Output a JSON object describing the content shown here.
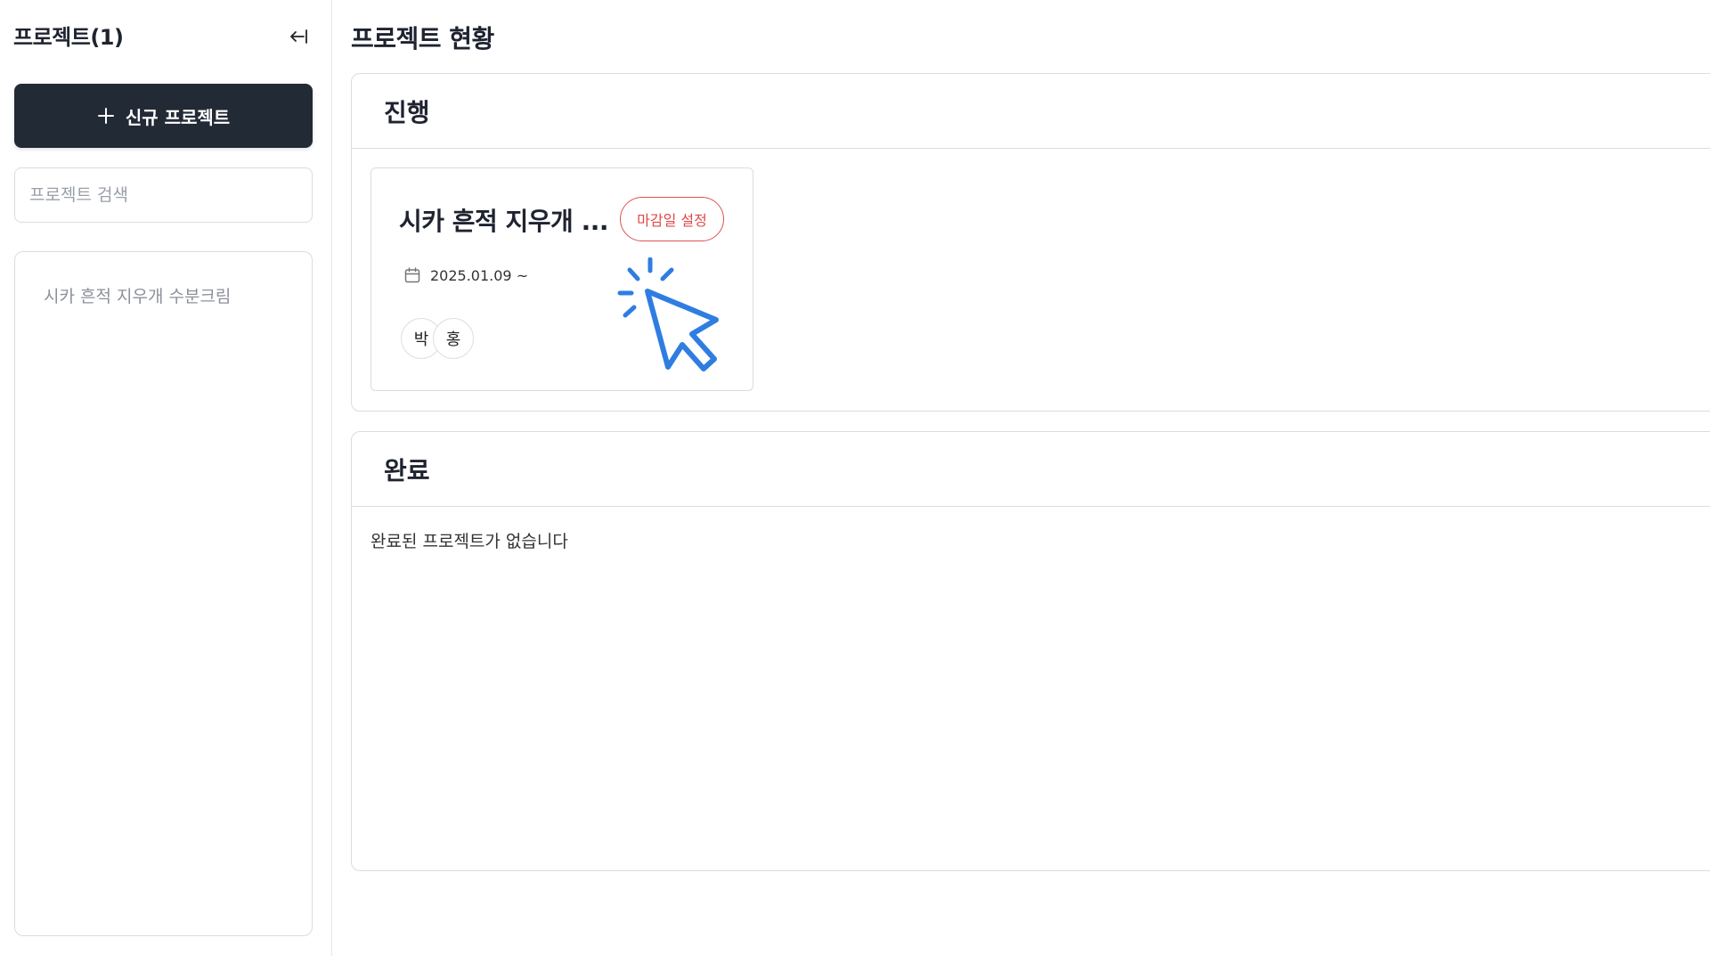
{
  "sidebar": {
    "title": "프로젝트(1)",
    "collapse_icon": "collapse-left-icon",
    "new_button_label": "신규 프로젝트",
    "search_placeholder": "프로젝트 검색",
    "projects": [
      {
        "name": "시카 흔적 지우개 수분크림"
      }
    ]
  },
  "main": {
    "title": "프로젝트 현황",
    "in_progress": {
      "heading": "진행",
      "cards": [
        {
          "title": "시카 흔적 지우개 ...",
          "deadline_label": "마감일 설정",
          "date_range": "2025.01.09 ~",
          "members": [
            "박",
            "홍"
          ]
        }
      ]
    },
    "completed": {
      "heading": "완료",
      "empty_message": "완료된 프로젝트가 없습니다"
    }
  },
  "colors": {
    "primary_button": "#222a36",
    "deadline_red": "#e05252",
    "cursor_blue": "#2f7de1",
    "border": "#d9dce2"
  }
}
